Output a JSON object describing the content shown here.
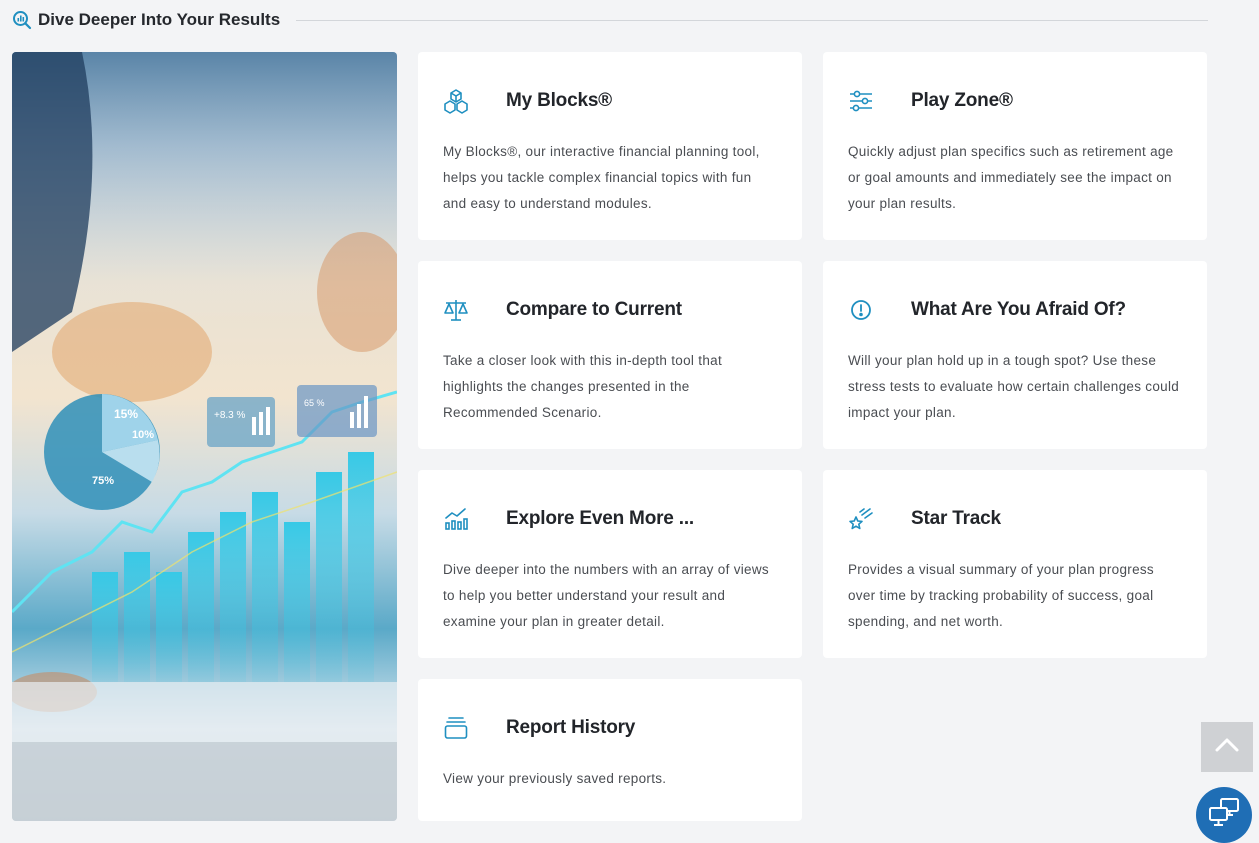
{
  "header": {
    "title": "Dive Deeper Into Your Results",
    "icon": "chart-search-icon"
  },
  "colors": {
    "accent": "#1f8fc0",
    "card_bg": "#ffffff",
    "page_bg": "#f3f4f6"
  },
  "hero": {
    "image": "financial-charts-photo"
  },
  "hero_overlay": [
    "15%",
    "10%",
    "75%",
    "+8.3 %",
    "65 %"
  ],
  "cards": [
    {
      "id": "my-blocks",
      "title": "My Blocks®",
      "icon": "cubes-icon",
      "description": "My Blocks®, our interactive financial planning tool, helps you tackle complex financial topics with fun and easy to understand modules."
    },
    {
      "id": "play-zone",
      "title": "Play Zone®",
      "icon": "sliders-icon",
      "description": "Quickly adjust plan specifics such as retirement age or goal amounts and immediately see the impact on your plan results."
    },
    {
      "id": "compare-to-current",
      "title": "Compare to Current",
      "icon": "balance-scale-icon",
      "description": "Take a closer look with this in-depth tool that highlights the changes presented in the Recommended Scenario."
    },
    {
      "id": "what-are-you-afraid-of",
      "title": "What Are You Afraid Of?",
      "icon": "alert-circle-icon",
      "description": "Will your plan hold up in a tough spot? Use these stress tests to evaluate how certain challenges could impact your plan."
    },
    {
      "id": "explore-even-more",
      "title": "Explore Even More ...",
      "icon": "chart-trend-icon",
      "description": "Dive deeper into the numbers with an array of views to help you better understand your result and examine your plan in greater detail."
    },
    {
      "id": "star-track",
      "title": "Star Track",
      "icon": "shooting-star-icon",
      "description": "Provides a visual summary of your plan progress over time by tracking probability of success, goal spending, and net worth."
    },
    {
      "id": "report-history",
      "title": "Report History",
      "icon": "report-stack-icon",
      "description": "View your previously saved reports."
    }
  ],
  "scroll_top": {
    "icon": "chevron-up-icon"
  },
  "support": {
    "icon": "remote-support-icon"
  }
}
